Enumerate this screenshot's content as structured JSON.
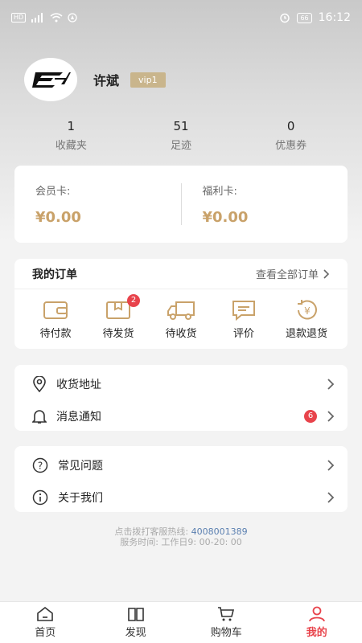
{
  "status": {
    "time": "16:12",
    "battery": "66",
    "net_label": "HD"
  },
  "profile": {
    "name": "许斌",
    "vip": "vip1"
  },
  "stats": [
    {
      "value": "1",
      "label": "收藏夹"
    },
    {
      "value": "51",
      "label": "足迹"
    },
    {
      "value": "0",
      "label": "优惠券"
    }
  ],
  "wallet": {
    "member_label": "会员卡:",
    "member_amount": "¥0.00",
    "welfare_label": "福利卡:",
    "welfare_amount": "¥0.00"
  },
  "orders": {
    "title": "我的订单",
    "view_all": "查看全部订单",
    "items": [
      {
        "label": "待付款",
        "icon": "wallet-icon",
        "badge": ""
      },
      {
        "label": "待发货",
        "icon": "package-icon",
        "badge": "2"
      },
      {
        "label": "待收货",
        "icon": "truck-icon",
        "badge": ""
      },
      {
        "label": "评价",
        "icon": "comment-icon",
        "badge": ""
      },
      {
        "label": "退款退货",
        "icon": "refund-icon",
        "badge": ""
      }
    ]
  },
  "menu1": [
    {
      "label": "收货地址",
      "icon": "location-icon"
    },
    {
      "label": "消息通知",
      "icon": "bell-icon",
      "count": "6"
    }
  ],
  "menu2": [
    {
      "label": "常见问题",
      "icon": "question-icon"
    },
    {
      "label": "关于我们",
      "icon": "info-icon"
    }
  ],
  "hotline": {
    "label": "点击拨打客服热线:",
    "phone": "4008001389",
    "hours": "服务时间: 工作日9: 00-20: 00"
  },
  "tabs": [
    {
      "label": "首页",
      "icon": "home-icon"
    },
    {
      "label": "发现",
      "icon": "book-icon"
    },
    {
      "label": "购物车",
      "icon": "cart-icon"
    },
    {
      "label": "我的",
      "icon": "user-icon",
      "active": true
    }
  ],
  "colors": {
    "accent": "#e8434b",
    "gold": "#c9a26a",
    "vip": "#c9b58c"
  }
}
